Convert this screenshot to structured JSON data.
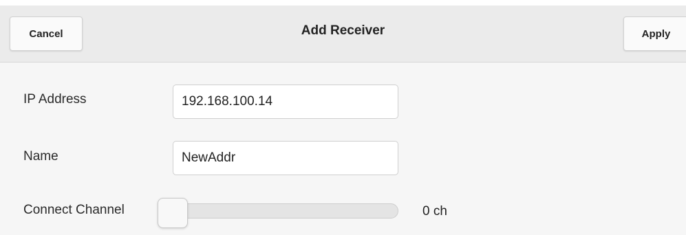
{
  "toolbar": {
    "cancel_label": "Cancel",
    "title": "Add Receiver",
    "apply_label": "Apply"
  },
  "form": {
    "ip_address": {
      "label": "IP Address",
      "value": "192.168.100.14"
    },
    "name": {
      "label": "Name",
      "value": "NewAddr"
    },
    "connect_channel": {
      "label": "Connect Channel",
      "value": 0,
      "display": "0 ch"
    }
  }
}
